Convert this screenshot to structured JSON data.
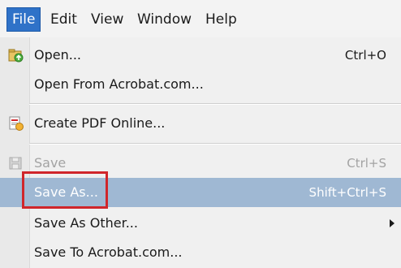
{
  "menubar": {
    "items": [
      {
        "label": "File"
      },
      {
        "label": "Edit"
      },
      {
        "label": "View"
      },
      {
        "label": "Window"
      },
      {
        "label": "Help"
      }
    ]
  },
  "file_menu": {
    "open": {
      "label": "Open...",
      "shortcut": "Ctrl+O",
      "icon": "open-folder-icon"
    },
    "open_from_acrobat": {
      "label": "Open From Acrobat.com..."
    },
    "create_pdf_online": {
      "label": "Create PDF Online...",
      "icon": "create-pdf-icon"
    },
    "save": {
      "label": "Save",
      "shortcut": "Ctrl+S",
      "icon": "floppy-disk-icon",
      "state": "disabled"
    },
    "save_as": {
      "label": "Save As...",
      "shortcut": "Shift+Ctrl+S",
      "state": "highlighted"
    },
    "save_as_other": {
      "label": "Save As Other...",
      "submenu_icon": "chevron-right-icon"
    },
    "save_to_acrobat": {
      "label": "Save To Acrobat.com..."
    }
  },
  "colors": {
    "active_menu": "#2f72c8",
    "highlight": "#9fb8d3",
    "annotation_box": "#d0262b"
  }
}
